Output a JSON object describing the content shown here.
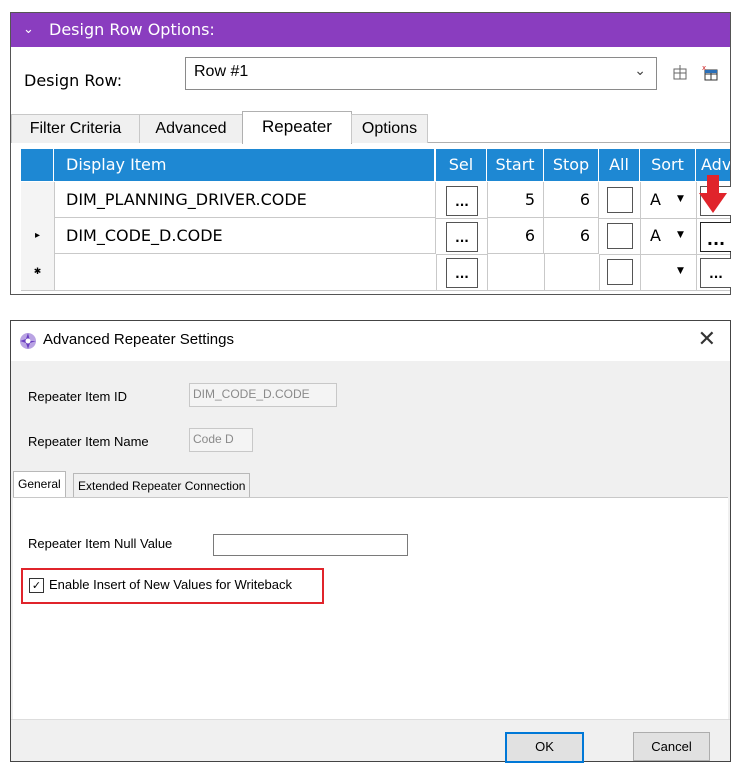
{
  "design_row_options": {
    "header_title": "Design Row Options:",
    "design_row_label": "Design Row:",
    "design_row_value": "Row #1",
    "tabs": [
      "Filter Criteria",
      "Advanced",
      "Repeater",
      "Options"
    ],
    "active_tab": "Repeater",
    "grid": {
      "columns": [
        "Display Item",
        "Sel",
        "Start",
        "Stop",
        "All",
        "Sort",
        "Adv"
      ],
      "rows": [
        {
          "display_item": "DIM_PLANNING_DRIVER.CODE",
          "sel": "...",
          "start": "5",
          "stop": "6",
          "sort": "A",
          "adv": ""
        },
        {
          "display_item": "DIM_CODE_D.CODE",
          "sel": "...",
          "start": "6",
          "stop": "6",
          "sort": "A",
          "adv": "..."
        },
        {
          "display_item": "",
          "sel": "...",
          "start": "",
          "stop": "",
          "sort": "",
          "adv": "..."
        }
      ],
      "row_markers": [
        "",
        "▸",
        "✱"
      ]
    },
    "accent_color": "#8a3dbf",
    "grid_header_color": "#1e88d3",
    "highlight_arrow_color": "#e0242b"
  },
  "dialog": {
    "title": "Advanced Repeater Settings",
    "repeater_item_id_label": "Repeater Item ID",
    "repeater_item_id_value": "DIM_CODE_D.CODE",
    "repeater_item_name_label": "Repeater Item Name",
    "repeater_item_name_value": "Code D",
    "tabs": [
      "General",
      "Extended Repeater Connection"
    ],
    "active_tab": "General",
    "null_value_label": "Repeater Item Null Value",
    "null_value": "",
    "enable_insert_label": "Enable Insert of New Values for Writeback",
    "enable_insert_checked": true,
    "ok_label": "OK",
    "cancel_label": "Cancel",
    "highlight_box_color": "#e0242b"
  }
}
